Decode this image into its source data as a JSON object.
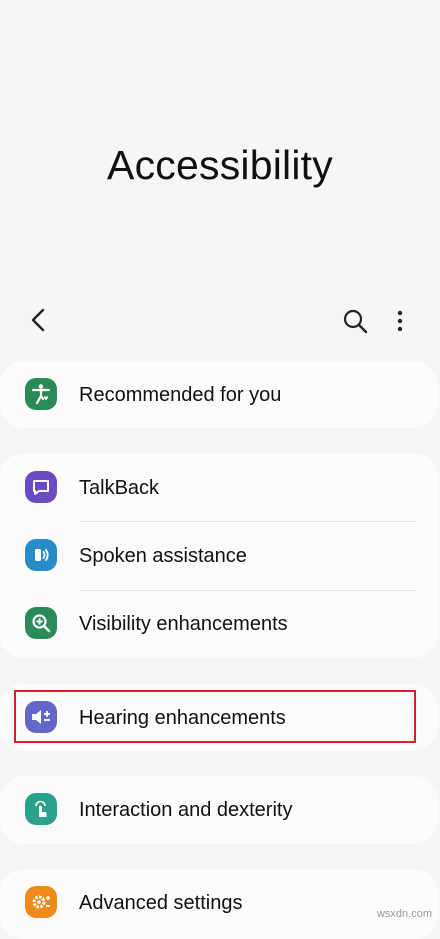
{
  "page": {
    "title": "Accessibility"
  },
  "toolbar": {
    "back_icon": "back-chevron-icon",
    "search_icon": "search-icon",
    "more_icon": "more-vert-icon"
  },
  "groups": [
    {
      "items": [
        {
          "label": "Recommended for you",
          "icon": "accessibility-person-icon",
          "color": "#2b8a5a"
        }
      ]
    },
    {
      "items": [
        {
          "label": "TalkBack",
          "icon": "talkback-icon",
          "color": "#6a4bc4"
        },
        {
          "label": "Spoken assistance",
          "icon": "spoken-assistance-icon",
          "color": "#2a8bc9"
        },
        {
          "label": "Visibility enhancements",
          "icon": "magnifier-icon",
          "color": "#2b8a5a"
        }
      ]
    },
    {
      "items": [
        {
          "label": "Hearing enhancements",
          "icon": "hearing-icon",
          "color": "#6467c8",
          "highlighted": true
        }
      ]
    },
    {
      "items": [
        {
          "label": "Interaction and dexterity",
          "icon": "touch-icon",
          "color": "#2aa189"
        }
      ]
    },
    {
      "items": [
        {
          "label": "Advanced settings",
          "icon": "advanced-settings-icon",
          "color": "#f08a1c"
        }
      ]
    }
  ],
  "watermark": "wsxdn.com"
}
